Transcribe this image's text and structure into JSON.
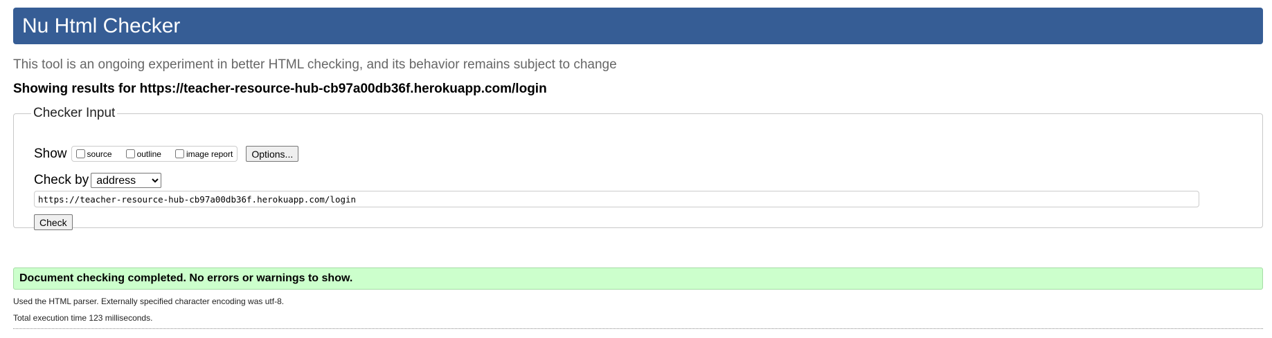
{
  "header": {
    "title": "Nu Html Checker"
  },
  "intro": {
    "text": "This tool is an ongoing experiment in better HTML checking, and its behavior remains subject to change"
  },
  "results": {
    "heading": "Showing results for https://teacher-resource-hub-cb97a00db36f.herokuapp.com/login"
  },
  "checker_input": {
    "legend": "Checker Input",
    "show": {
      "label": "Show",
      "options": [
        {
          "label": "source",
          "checked": false
        },
        {
          "label": "outline",
          "checked": false
        },
        {
          "label": "image report",
          "checked": false
        }
      ],
      "options_button": "Options..."
    },
    "check_by": {
      "label": "Check by",
      "selected": "address"
    },
    "url_value": "https://teacher-resource-hub-cb97a00db36f.herokuapp.com/login",
    "check_button": "Check"
  },
  "status": {
    "message": "Document checking completed. No errors or warnings to show.",
    "color": "#CCFFCC"
  },
  "notes": {
    "parser": "Used the HTML parser. Externally specified character encoding was utf-8.",
    "time": "Total execution time 123 milliseconds."
  },
  "colors": {
    "header_bg": "#365D95",
    "intro_text": "#666666"
  }
}
